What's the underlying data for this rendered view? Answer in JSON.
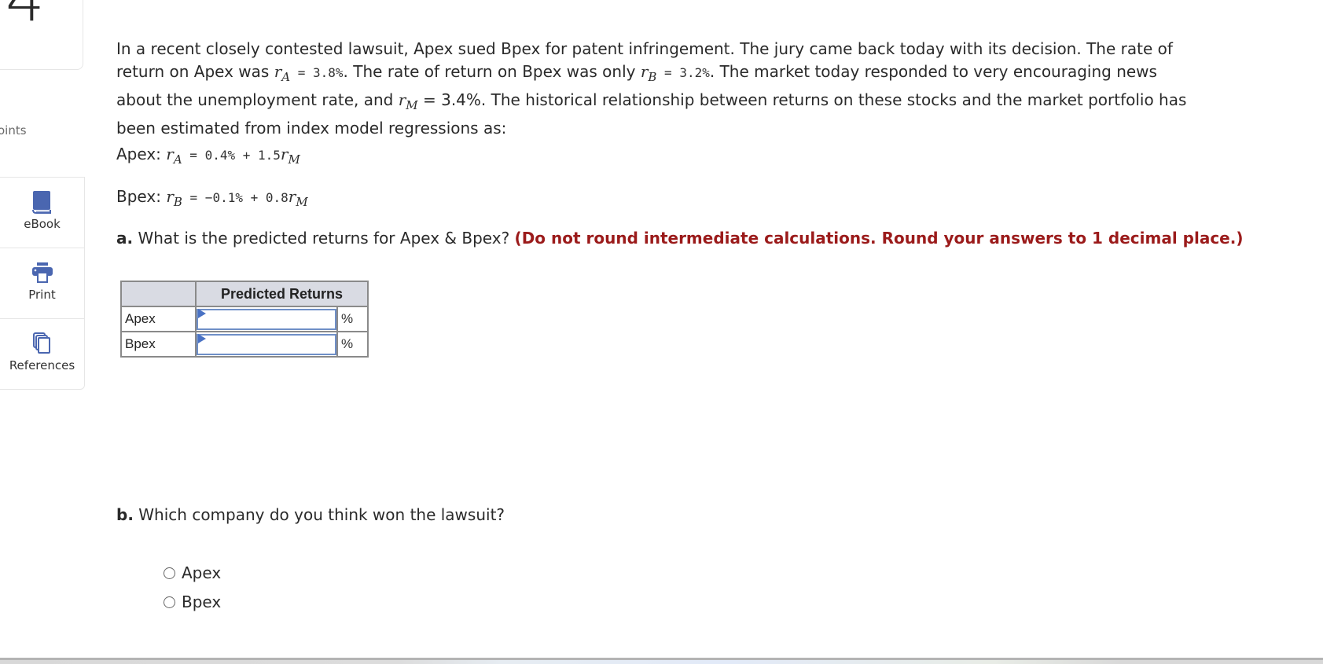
{
  "sidebar": {
    "question_number": "4",
    "points_label": "oints",
    "tools": [
      {
        "label": "eBook",
        "icon": "book-icon"
      },
      {
        "label": "Print",
        "icon": "printer-icon"
      },
      {
        "label": "References",
        "icon": "copy-documents-icon"
      }
    ]
  },
  "problem": {
    "intro_1": "In a recent closely contested lawsuit, Apex sued Bpex for patent infringement. The jury came back today with its decision. The rate of return on Apex was ",
    "rA_var": "r",
    "rA_sub": "A",
    "rA_value": " = 3.8%",
    "intro_2": ". The rate of return on Bpex was only ",
    "rB_var": "r",
    "rB_sub": "B",
    "rB_value": " = 3.2%",
    "intro_3": ". The market today responded to very encouraging news about the unemployment rate, and ",
    "rM_var": "r",
    "rM_sub": "M",
    "rM_value": " = 3.4%",
    "intro_4": ". The historical relationship between returns on these stocks and the market portfolio has been estimated from index model regressions as:",
    "eq_apex": {
      "label": "Apex: ",
      "var": "r",
      "sub": "A",
      "rhs": " = 0.4% + 1.5",
      "tail_var": "r",
      "tail_sub": "M"
    },
    "eq_bpex": {
      "label": "Bpex: ",
      "var": "r",
      "sub": "B",
      "rhs": " = −0.1% + 0.8",
      "tail_var": "r",
      "tail_sub": "M"
    }
  },
  "part_a": {
    "lead": "a.",
    "question": " What is the predicted returns for Apex & Bpex? ",
    "instruction": "(Do not round intermediate calculations. Round your answers to 1 decimal place.)",
    "table": {
      "header_blank": "",
      "header": "Predicted Returns",
      "rows": [
        {
          "label": "Apex",
          "value": "",
          "unit": "%"
        },
        {
          "label": "Bpex",
          "value": "",
          "unit": "%"
        }
      ]
    }
  },
  "part_b": {
    "lead": "b.",
    "question": " Which company do you think won the lawsuit?",
    "options": [
      {
        "label": "Apex",
        "selected": false
      },
      {
        "label": "Bpex",
        "selected": false
      }
    ]
  }
}
